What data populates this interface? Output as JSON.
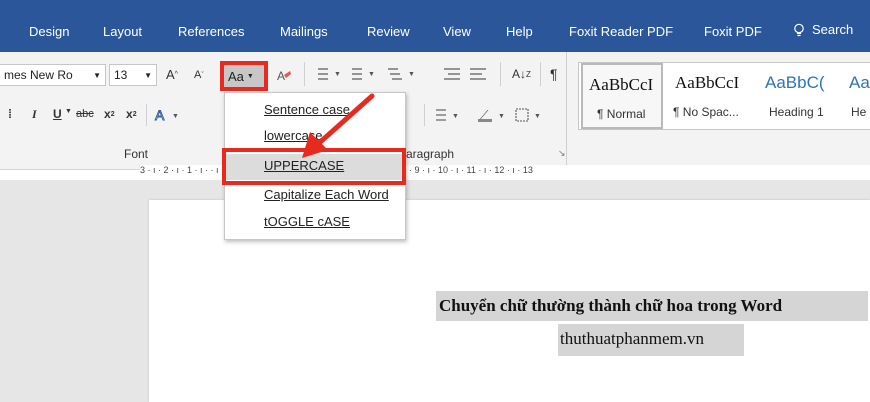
{
  "tabs": [
    {
      "label": "Design"
    },
    {
      "label": "Layout"
    },
    {
      "label": "References"
    },
    {
      "label": "Mailings"
    },
    {
      "label": "Review"
    },
    {
      "label": "View"
    },
    {
      "label": "Help"
    },
    {
      "label": "Foxit Reader PDF"
    },
    {
      "label": "Foxit PDF"
    },
    {
      "label": "Search"
    }
  ],
  "font": {
    "name": "mes New Ro",
    "size": "13",
    "grow": "A",
    "shrink": "A",
    "change_case": "Aa",
    "bold": "B",
    "italic": "I",
    "underline": "U",
    "strikethrough": "abc",
    "subscript": "x",
    "superscript": "x",
    "group_label": "Font"
  },
  "paragraph": {
    "group_label": "aragraph",
    "sort": "Z",
    "pilcrow": "¶"
  },
  "styles": [
    {
      "preview": "AaBbCcI",
      "name": "¶ Normal"
    },
    {
      "preview": "AaBbCcI",
      "name": "¶ No Spac..."
    },
    {
      "preview": "AaBbC(",
      "name": "Heading 1"
    },
    {
      "preview": "Aa",
      "name": "He"
    }
  ],
  "case_menu": {
    "items": [
      {
        "label": "Sentence case."
      },
      {
        "label": "lowercase"
      },
      {
        "label": "UPPERCASE"
      },
      {
        "label": "Capitalize Each Word"
      },
      {
        "label": "tOGGLE cASE"
      }
    ],
    "selected_index": 2
  },
  "ruler": {
    "text": "3 · ı · 2 · ı · 1 · ı ·     · ı · 1 · ı · 2 · ı · 3 · ı · 4 · ı · 5 · ı · 6 · ı · 7 · ı · 8 · ı · 9 · ı · 10 · ı · 11 · ı · 12 · ı · 13"
  },
  "document": {
    "line1": "Chuyển chữ thường thành chữ hoa trong Word",
    "line2": "thuthuatphanmem.vn"
  },
  "colors": {
    "tab_bar": "#2b579a",
    "highlight_box": "#e62a1f",
    "heading_style": "#2e74b5"
  }
}
